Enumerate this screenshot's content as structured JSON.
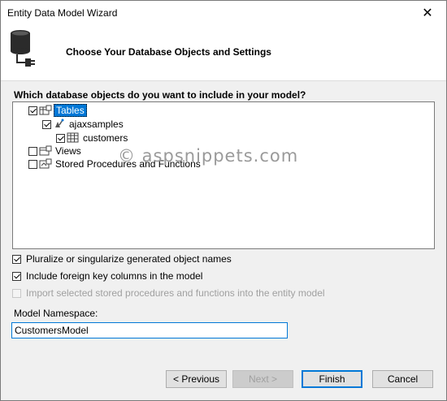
{
  "window": {
    "title": "Entity Data Model Wizard",
    "close_glyph": "✕"
  },
  "header": {
    "title": "Choose Your Database Objects and Settings",
    "icon": "database-connect-icon"
  },
  "question": "Which database objects do you want to include in your model?",
  "tree": {
    "tables": {
      "label": "Tables",
      "checked": true
    },
    "schema": {
      "label": "ajaxsamples",
      "checked": true
    },
    "table_customers": {
      "label": "customers",
      "checked": true
    },
    "views": {
      "label": "Views",
      "checked": false
    },
    "procs": {
      "label": "Stored Procedures and Functions",
      "checked": false
    }
  },
  "watermark": "© aspsnippets.com",
  "options": {
    "pluralize": {
      "label": "Pluralize or singularize generated object names",
      "checked": true
    },
    "foreign_keys": {
      "label": "Include foreign key columns in the model",
      "checked": true
    },
    "import_procs": {
      "label": "Import selected stored procedures and functions into the entity model",
      "checked": false,
      "enabled": false
    }
  },
  "namespace": {
    "label": "Model Namespace:",
    "value": "CustomersModel"
  },
  "buttons": {
    "previous": "< Previous",
    "next": "Next >",
    "finish": "Finish",
    "cancel": "Cancel"
  },
  "colors": {
    "selection": "#0078d7",
    "focus_border": "#0078d7"
  }
}
